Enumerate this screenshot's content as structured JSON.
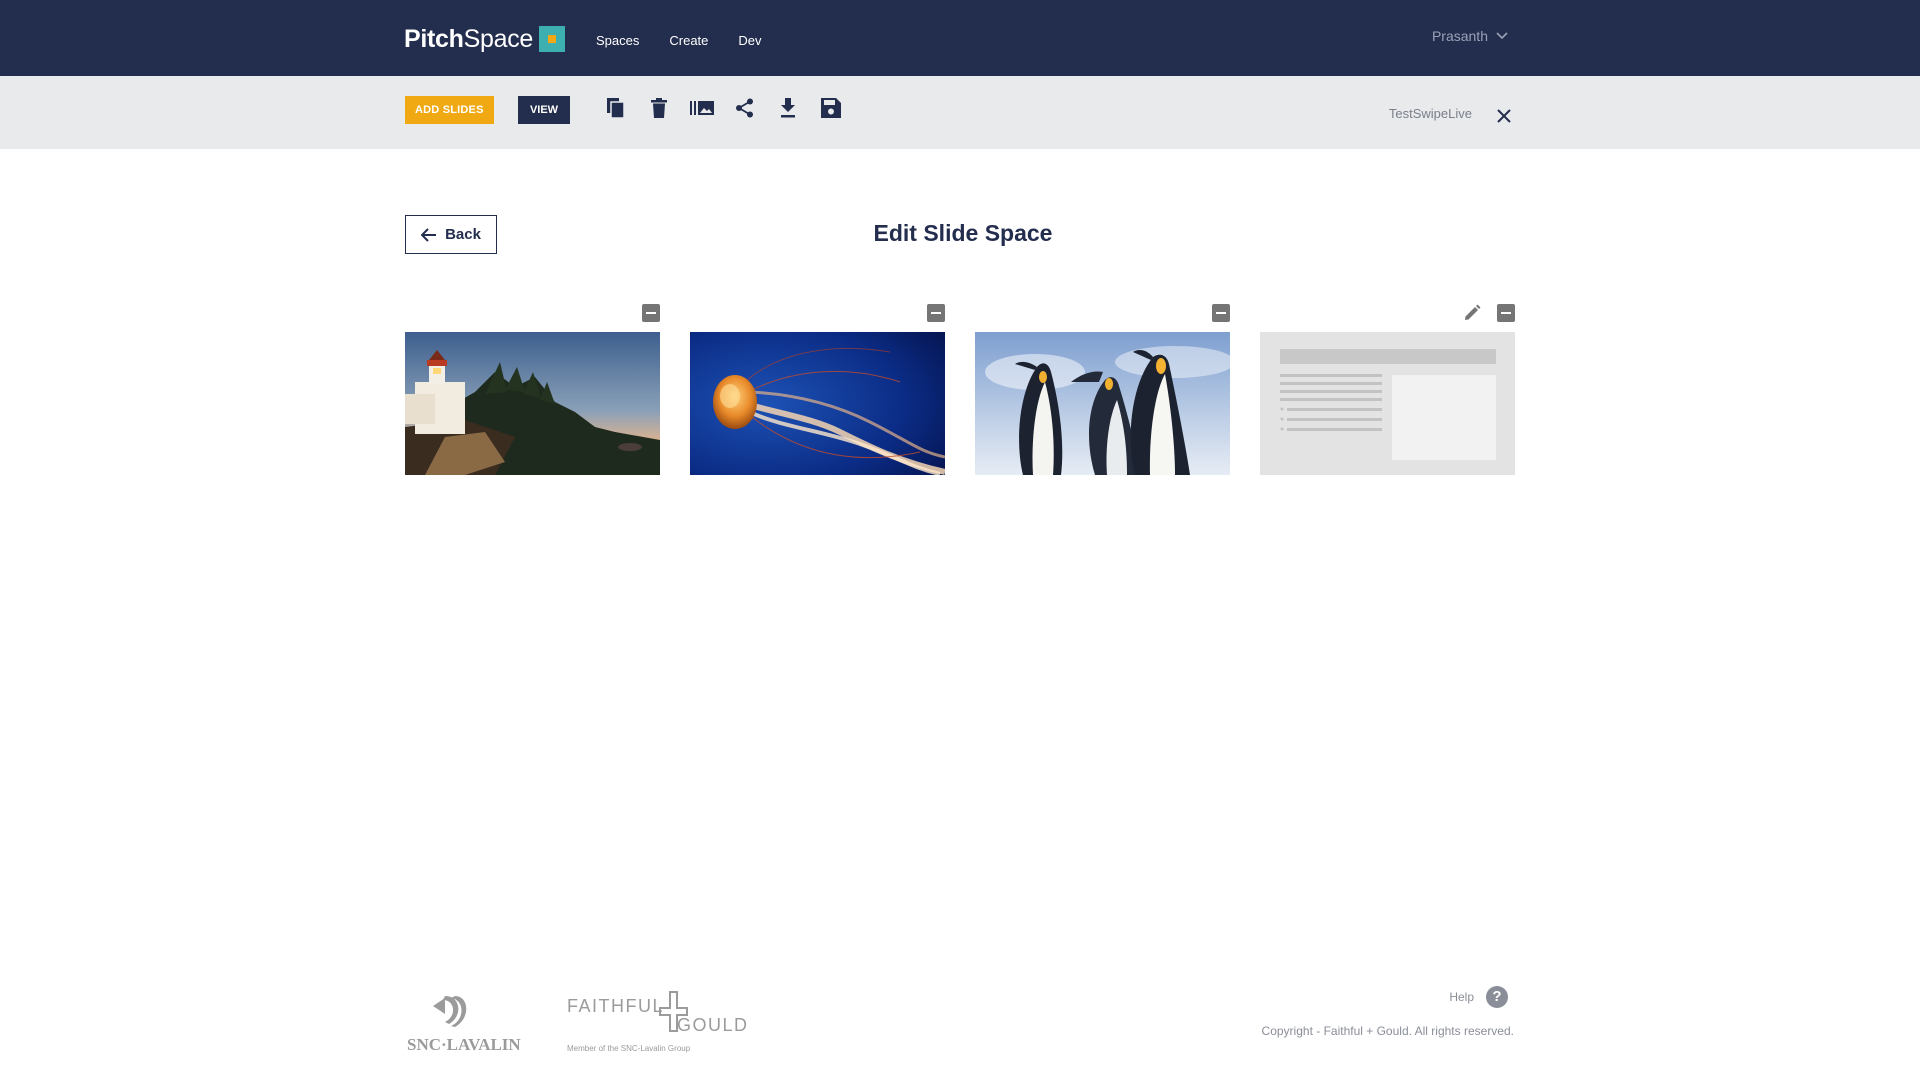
{
  "header": {
    "brand_bold": "Pitch",
    "brand_regular": "Space",
    "nav": [
      "Spaces",
      "Create",
      "Dev"
    ],
    "user_name": "Prasanth"
  },
  "toolbar": {
    "add_slides_label": "ADD SLIDES",
    "view_label": "VIEW",
    "icons": [
      "copy-icon",
      "trash-icon",
      "slides-library-icon",
      "share-icon",
      "download-icon",
      "save-icon"
    ],
    "space_name": "TestSwipeLive"
  },
  "main": {
    "back_label": "Back",
    "title": "Edit Slide Space",
    "slides": [
      {
        "name": "lighthouse",
        "actions": [
          "remove"
        ]
      },
      {
        "name": "jellyfish",
        "actions": [
          "remove"
        ]
      },
      {
        "name": "penguins",
        "actions": [
          "remove"
        ]
      },
      {
        "name": "text-layout-template",
        "actions": [
          "edit",
          "remove"
        ]
      }
    ]
  },
  "footer": {
    "snc_logo_text": "SNC·LAVALIN",
    "fg_logo_left": "FAITHFUL",
    "fg_logo_right": "GOULD",
    "fg_tagline": "Member of the SNC-Lavalin Group",
    "help_label": "Help",
    "help_glyph": "?",
    "copyright": "Copyright - Faithful + Gould. All rights reserved."
  },
  "colors": {
    "nav_bg": "#232d4d",
    "toolbar_bg": "#e9eaec",
    "accent": "#f0a913",
    "brand_teal": "#3dafb0"
  }
}
